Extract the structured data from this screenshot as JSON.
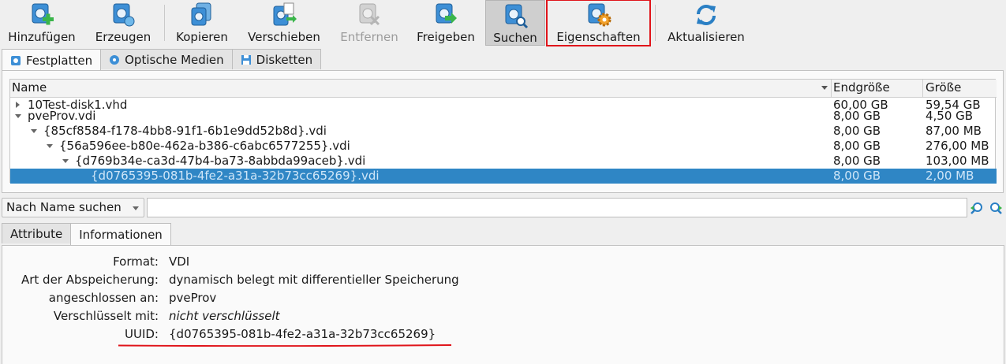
{
  "toolbar": {
    "add": "Hinzufügen",
    "create": "Erzeugen",
    "copy": "Kopieren",
    "move": "Verschieben",
    "remove": "Entfernen",
    "release": "Freigeben",
    "search": "Suchen",
    "properties": "Eigenschaften",
    "refresh": "Aktualisieren"
  },
  "media_tabs": [
    {
      "label": "Festplatten",
      "selected": true
    },
    {
      "label": "Optische Medien",
      "selected": false
    },
    {
      "label": "Disketten",
      "selected": false
    }
  ],
  "columns": {
    "name": "Name",
    "virtual_size": "Endgröße",
    "actual_size": "Größe"
  },
  "rows": [
    {
      "name": "10Test-disk1.vhd",
      "virtual_size": "60,00 GB",
      "actual_size": "59,54 GB",
      "depth": 0,
      "expander": "collapsed"
    },
    {
      "name": "pveProv.vdi",
      "virtual_size": "8,00 GB",
      "actual_size": "4,50 GB",
      "depth": 0,
      "expander": "expanded"
    },
    {
      "name": "{85cf8584-f178-4bb8-91f1-6b1e9dd52b8d}.vdi",
      "virtual_size": "8,00 GB",
      "actual_size": "87,00 MB",
      "depth": 1,
      "expander": "expanded"
    },
    {
      "name": "{56a596ee-b80e-462a-b386-c6abc6577255}.vdi",
      "virtual_size": "8,00 GB",
      "actual_size": "276,00 MB",
      "depth": 2,
      "expander": "expanded"
    },
    {
      "name": "{d769b34e-ca3d-47b4-ba73-8abbda99aceb}.vdi",
      "virtual_size": "8,00 GB",
      "actual_size": "103,00 MB",
      "depth": 3,
      "expander": "expanded"
    },
    {
      "name": "{d0765395-081b-4fe2-a31a-32b73cc65269}.vdi",
      "virtual_size": "8,00 GB",
      "actual_size": "2,00 MB",
      "depth": 4,
      "expander": "none",
      "selected": true
    }
  ],
  "search": {
    "mode": "Nach Name suchen",
    "value": ""
  },
  "detail_tabs": [
    {
      "label": "Attribute",
      "selected": false
    },
    {
      "label": "Informationen",
      "selected": true
    }
  ],
  "info": {
    "format_label": "Format:",
    "format_value": "VDI",
    "storage_label": "Art der Abspeicherung:",
    "storage_value": "dynamisch belegt mit differentieller Speicherung",
    "attached_label": "angeschlossen an:",
    "attached_value": "pveProv",
    "encrypted_label": "Verschlüsselt mit:",
    "encrypted_value": "nicht verschlüsselt",
    "uuid_label": "UUID:",
    "uuid_value": "{d0765395-081b-4fe2-a31a-32b73cc65269}"
  },
  "colors": {
    "selection": "#2f86c5",
    "highlight": "#e0141a",
    "icon_blue": "#2a7fc4",
    "icon_green": "#3ab54a"
  }
}
